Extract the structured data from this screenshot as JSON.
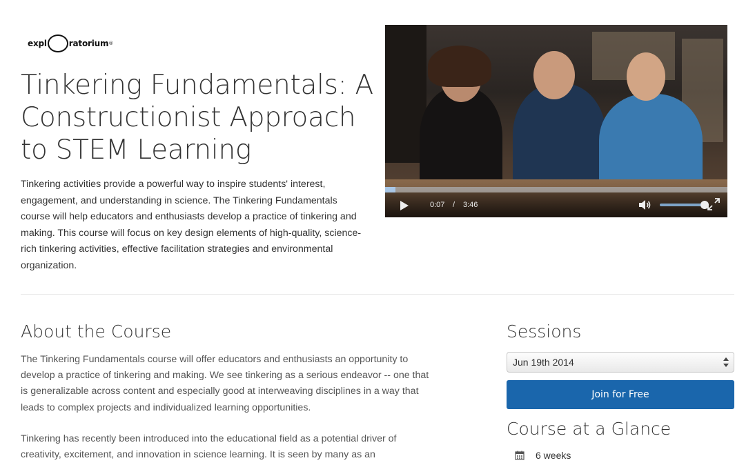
{
  "logo": {
    "left": "expl",
    "right": "ratorium",
    "mark": "®",
    "icon": "exploratorium-logo"
  },
  "course": {
    "title": "Tinkering Fundamentals: A Constructionist Approach to STEM Learning",
    "intro": "Tinkering activities provide a powerful way to inspire students' interest, engagement, and understanding in science. The Tinkering Fundamentals course will help educators and enthusiasts develop a practice of tinkering and making. This course will focus on key design elements of high-quality, science-rich tinkering activities, effective facilitation strategies and environmental organization."
  },
  "video": {
    "current_time": "0:07",
    "separator": "/",
    "duration": "3:46",
    "progress_fraction": 0.03,
    "volume_fraction": 0.9,
    "icons": [
      "play-icon",
      "volume-icon",
      "fullscreen-icon"
    ]
  },
  "about": {
    "heading": "About the Course",
    "paragraph1": "The Tinkering Fundamentals course will offer educators and enthusiasts an opportunity to develop a practice of tinkering and making.  We see tinkering as a serious endeavor -- one that is generalizable across content and especially good at interweaving disciplines in a way that leads to complex projects and individualized learning opportunities.",
    "paragraph2": "Tinkering has recently been introduced into the educational field as a potential driver of creativity, excitement, and innovation in science learning. It is seen by many as an"
  },
  "sidebar": {
    "sessions_heading": "Sessions",
    "session_selected": "Jun 19th 2014",
    "join_label": "Join for Free",
    "glance_heading": "Course at a Glance",
    "glance_items": [
      {
        "icon": "calendar-icon",
        "text": "6 weeks"
      }
    ]
  },
  "colors": {
    "primary_button": "#1a66ac",
    "text": "#333333",
    "body_text": "#555555",
    "divider": "#e6e6e6"
  }
}
